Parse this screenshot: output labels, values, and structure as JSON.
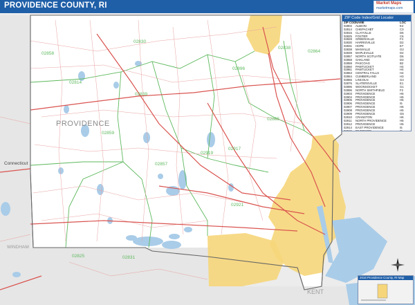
{
  "title": "PROVIDENCE COUNTY, RI",
  "logo": {
    "top": "Market Maps",
    "bottom": "marketmaps.com"
  },
  "map": {
    "colors": {
      "water": "#a9cce8",
      "urban": "#f6d67a",
      "road_major": "#d9534f",
      "road_minor": "#e8a0a0",
      "zip_boundary": "#5cb85c",
      "county_boundary": "#666666",
      "outside": "#ececec",
      "county": "#ffffff"
    },
    "labels": {
      "county": "PROVIDENCE",
      "connecticut": "Connecticut",
      "windham": "WINDHAM",
      "kent": "KENT",
      "zips": [
        "02830",
        "02858",
        "02839",
        "02859",
        "02814",
        "02857",
        "02825",
        "02831",
        "02896",
        "02865",
        "02864",
        "02917",
        "02919",
        "02921",
        "02838"
      ]
    }
  },
  "legend": {
    "header": "ZIP Code Index/Grid Locator",
    "columns": [
      "ZIP CODE",
      "NAME",
      "LOC"
    ],
    "rows": [
      [
        "02802",
        "ALBION",
        "E4"
      ],
      [
        "02814",
        "CHEPACHET",
        "C3"
      ],
      [
        "02815",
        "CLAYVILLE",
        "D6"
      ],
      [
        "02825",
        "FOSTER",
        "C6"
      ],
      [
        "02828",
        "GREENVILLE",
        "F4"
      ],
      [
        "02830",
        "HARRISVILLE",
        "D2"
      ],
      [
        "02831",
        "HOPE",
        "E7"
      ],
      [
        "02838",
        "MANVILLE",
        "G2"
      ],
      [
        "02839",
        "MAPLEVILLE",
        "D2"
      ],
      [
        "02857",
        "NORTH SCITUATE",
        "D6"
      ],
      [
        "02858",
        "OAKLAND",
        "D3"
      ],
      [
        "02859",
        "PASCOAG",
        "B2"
      ],
      [
        "02860",
        "PAWTUCKET",
        "H4"
      ],
      [
        "02861",
        "PAWTUCKET",
        "H4"
      ],
      [
        "02863",
        "CENTRAL FALLS",
        "H4"
      ],
      [
        "02864",
        "CUMBERLAND",
        "H3"
      ],
      [
        "02865",
        "LINCOLN",
        "G4"
      ],
      [
        "02876",
        "SLATERSVILLE",
        "E1"
      ],
      [
        "02895",
        "WOONSOCKET",
        "G1"
      ],
      [
        "02896",
        "NORTH SMITHFIELD",
        "F2"
      ],
      [
        "02903",
        "PROVIDENCE",
        "H6"
      ],
      [
        "02904",
        "PROVIDENCE",
        "H5"
      ],
      [
        "02905",
        "PROVIDENCE",
        "H6"
      ],
      [
        "02906",
        "PROVIDENCE",
        "I5"
      ],
      [
        "02907",
        "PROVIDENCE",
        "H6"
      ],
      [
        "02908",
        "PROVIDENCE",
        "H5"
      ],
      [
        "02909",
        "PROVIDENCE",
        "G5"
      ],
      [
        "02910",
        "CRANSTON",
        "H6"
      ],
      [
        "02911",
        "NORTH PROVIDENCE",
        "H5"
      ],
      [
        "02912",
        "PROVIDENCE",
        "H5"
      ],
      [
        "02914",
        "EAST PROVIDENCE",
        "I5"
      ],
      [
        "02915",
        "RIVERSIDE",
        "I6"
      ],
      [
        "02916",
        "RUMFORD",
        "I5"
      ],
      [
        "02917",
        "SMITHFIELD",
        "F3"
      ],
      [
        "02919",
        "JOHNSTON",
        "F5"
      ],
      [
        "02920",
        "CRANSTON",
        "G6"
      ],
      [
        "02921",
        "CRANSTON",
        "F7"
      ]
    ]
  },
  "inset": {
    "title": "2016 Providence County, RI Map"
  }
}
